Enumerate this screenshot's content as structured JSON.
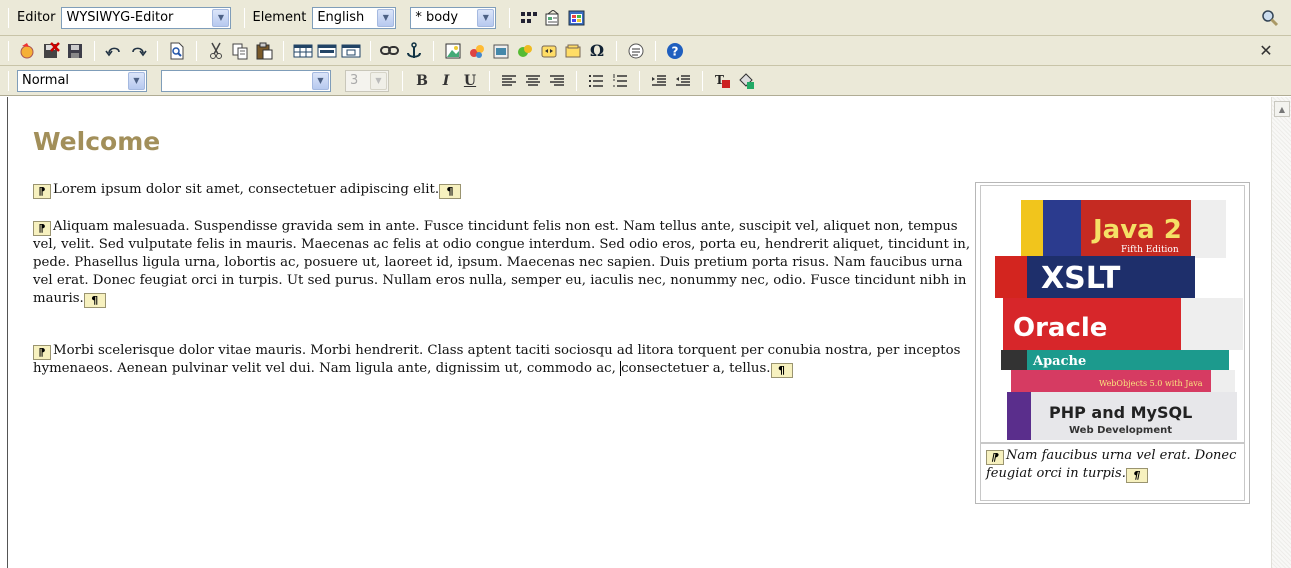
{
  "toolbar1": {
    "editor_label": "Editor",
    "editor_select": "WYSIWYG-Editor",
    "element_label": "Element",
    "language_select": "English",
    "scope_select": "* body"
  },
  "toolbar3": {
    "format_select": "Normal",
    "font_select": "",
    "size_select": "3",
    "bold": "B",
    "italic": "I",
    "underline": "U"
  },
  "content": {
    "heading": "Welcome",
    "para_mark": "¶",
    "para_start": "⁋",
    "p1": "Lorem ipsum dolor sit amet, consectetuer adipiscing elit.",
    "p2": "Aliquam malesuada. Suspendisse gravida sem in ante. Fusce tincidunt felis non est. Nam tellus ante, suscipit vel, aliquet non, tempus vel, velit. Sed vulputate felis in mauris. Maecenas ac felis at odio congue interdum. Sed odio eros, porta eu, hendrerit aliquet, tincidunt in, pede. Phasellus ligula urna, lobortis ac, posuere ut, laoreet id, ipsum. Maecenas nec sapien. Duis pretium porta risus. Nam faucibus urna vel erat. Donec feugiat orci in turpis. Ut sed purus. Nullam eros nulla, semper eu, iaculis nec, nonummy nec, odio. Fusce tincidunt nibh in mauris.",
    "p3_before_caret": "Morbi scelerisque dolor vitae mauris. Morbi hendrerit. Class aptent taciti sociosqu ad litora torquent per conubia nostra, per inceptos hymenaeos. Aenean pulvinar velit vel dui. Nam ligula ante, dignissim ut, commodo ac, ",
    "p3_after_caret": "consectetuer a, tellus.",
    "caption": "Nam faucibus urna vel erat. Donec feugiat orci in turpis."
  },
  "books": {
    "java": "Java 2",
    "java_sub": "Fifth Edition",
    "xslt": "XSLT",
    "oracle": "Oracle",
    "apache": "Apache",
    "webobjects": "WebObjects 5.0 with Java",
    "php": "PHP and MySQL",
    "php_sub": "Web Development"
  },
  "colors": {
    "toolbar_bg": "#ebe9d8",
    "heading": "#a28f5a",
    "para_mark_bg": "#f7f1bf"
  }
}
